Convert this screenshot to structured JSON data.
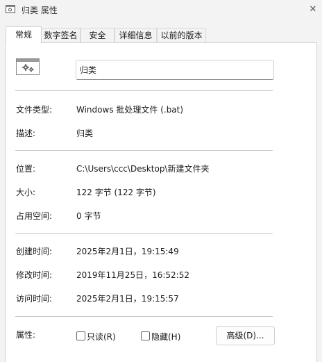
{
  "window": {
    "title": "归类 属性",
    "close_glyph": "✕"
  },
  "tabs": [
    {
      "label": "常规",
      "active": true
    },
    {
      "label": "数字签名",
      "active": false
    },
    {
      "label": "安全",
      "active": false
    },
    {
      "label": "详细信息",
      "active": false
    },
    {
      "label": "以前的版本",
      "active": false
    }
  ],
  "general": {
    "file_icon": "batch-file-gear-icon",
    "file_name": "归类",
    "rows": [
      {
        "label": "文件类型:",
        "value": "Windows 批处理文件 (.bat)"
      },
      {
        "label": "描述:",
        "value": "归类"
      },
      {
        "label": "位置:",
        "value": "C:\\Users\\ccc\\Desktop\\新建文件夹"
      },
      {
        "label": "大小:",
        "value": "122 字节 (122 字节)"
      },
      {
        "label": "占用空间:",
        "value": "0 字节"
      },
      {
        "label": "创建时间:",
        "value": "2025年2月1日，19:15:49"
      },
      {
        "label": "修改时间:",
        "value": "2019年11月25日，16:52:52"
      },
      {
        "label": "访问时间:",
        "value": "2025年2月1日，19:15:57"
      }
    ],
    "attributes": {
      "label": "属性:",
      "readonly": {
        "label": "只读(R)",
        "checked": false
      },
      "hidden": {
        "label": "隐藏(H)",
        "checked": false
      },
      "advanced_button": "高级(D)..."
    }
  },
  "colors": {
    "panel_bg": "#ffffff",
    "window_bg": "#f3f3f3",
    "separator": "#c8c8c8"
  }
}
